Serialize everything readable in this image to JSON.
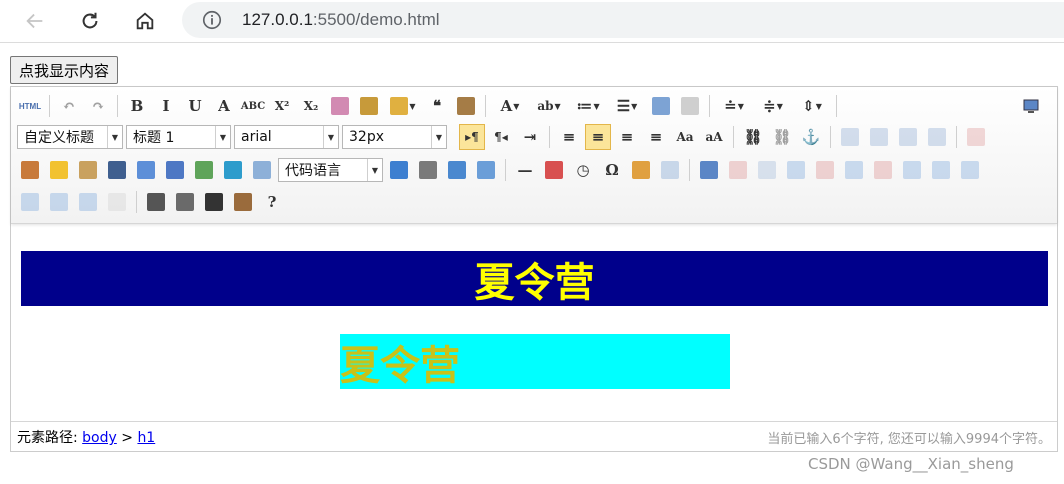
{
  "browser": {
    "url_host": "127.0.0.1",
    "url_rest": ":5500/demo.html"
  },
  "page": {
    "show_button": "点我显示内容"
  },
  "toolbar": {
    "row1": [
      {
        "name": "source-html-icon",
        "label": "HTML",
        "kind": "text"
      },
      {
        "sep": true
      },
      {
        "name": "undo-icon",
        "glyph": "↶",
        "disabled": true
      },
      {
        "name": "redo-icon",
        "glyph": "↷",
        "disabled": true
      },
      {
        "sep": true
      },
      {
        "name": "bold-icon",
        "glyph": "B"
      },
      {
        "name": "italic-icon",
        "glyph": "I"
      },
      {
        "name": "underline-icon",
        "glyph": "U"
      },
      {
        "name": "font-border-icon",
        "glyph": "A"
      },
      {
        "name": "strikethrough-icon",
        "glyph": "ABC"
      },
      {
        "name": "superscript-icon",
        "glyph": "X²"
      },
      {
        "name": "subscript-icon",
        "glyph": "X₂"
      },
      {
        "name": "eraser-icon",
        "color": "#d28ab2"
      },
      {
        "name": "format-brush-icon",
        "color": "#c79a3a"
      },
      {
        "name": "auto-format-icon",
        "color": "#e0b040",
        "caret": true
      },
      {
        "name": "blockquote-icon",
        "glyph": "❝"
      },
      {
        "name": "paste-plain-icon",
        "color": "#a57c46"
      },
      {
        "sep": true
      },
      {
        "name": "font-color-icon",
        "glyph": "A",
        "caret": true
      },
      {
        "name": "background-color-icon",
        "glyph": "ab",
        "caret": true
      },
      {
        "name": "ordered-list-icon",
        "glyph": "≔",
        "caret": true
      },
      {
        "name": "unordered-list-icon",
        "glyph": "☰",
        "caret": true
      },
      {
        "name": "select-all-icon",
        "color": "#7da3d4"
      },
      {
        "name": "clear-doc-icon",
        "color": "#cfcfcf"
      },
      {
        "sep": true
      },
      {
        "name": "row-spacing-top-icon",
        "glyph": "≐",
        "caret": true
      },
      {
        "name": "row-spacing-bottom-icon",
        "glyph": "≑",
        "caret": true
      },
      {
        "name": "line-height-icon",
        "glyph": "⇕",
        "caret": true
      },
      {
        "sep": true
      }
    ],
    "preview_icon": "preview-icon",
    "row2_combos": {
      "custom_style": "自定义标题",
      "paragraph": "标题 1",
      "font_family": "arial",
      "font_size": "32px"
    },
    "row2": [
      {
        "name": "direction-ltr-icon",
        "glyph": "▸¶",
        "active": true
      },
      {
        "name": "direction-rtl-icon",
        "glyph": "¶◂"
      },
      {
        "name": "indent-icon",
        "glyph": "⇥"
      },
      {
        "sep": true
      },
      {
        "name": "justify-left-icon",
        "glyph": "≡"
      },
      {
        "name": "justify-center-icon",
        "glyph": "≡",
        "active": true
      },
      {
        "name": "justify-right-icon",
        "glyph": "≡"
      },
      {
        "name": "justify-full-icon",
        "glyph": "≡"
      },
      {
        "name": "to-uppercase-icon",
        "glyph": "Aa"
      },
      {
        "name": "to-lowercase-icon",
        "glyph": "aA"
      },
      {
        "sep": true
      },
      {
        "name": "link-icon",
        "glyph": "⛓"
      },
      {
        "name": "unlink-icon",
        "glyph": "⛓",
        "disabled": true
      },
      {
        "name": "anchor-icon",
        "glyph": "⚓"
      },
      {
        "sep": true
      },
      {
        "name": "image-none-icon",
        "color": "#9fb8da",
        "disabled": true
      },
      {
        "name": "image-left-icon",
        "color": "#9fb8da",
        "disabled": true
      },
      {
        "name": "image-right-icon",
        "color": "#9fb8da",
        "disabled": true
      },
      {
        "name": "image-center-icon",
        "color": "#9fb8da",
        "disabled": true
      },
      {
        "sep": true
      },
      {
        "name": "simple-upload-icon",
        "color": "#e2a9a9",
        "disabled": true
      }
    ],
    "row3a": [
      {
        "name": "insert-image-icon",
        "color": "#c87a3b"
      },
      {
        "name": "emotion-icon",
        "color": "#f2c230"
      },
      {
        "name": "scrawl-icon",
        "color": "#c9a15f"
      },
      {
        "name": "insert-video-icon",
        "color": "#3f5f8f"
      },
      {
        "name": "music-icon",
        "color": "#5d8fd8"
      },
      {
        "name": "attachment-icon",
        "color": "#4e78c4"
      },
      {
        "name": "map-icon",
        "color": "#5fa45a"
      },
      {
        "name": "google-map-icon",
        "color": "#2d9ccc"
      },
      {
        "name": "insert-frame-icon",
        "color": "#8db0d8"
      }
    ],
    "code_language": "代码语言",
    "row3b": [
      {
        "name": "page-break-icon",
        "color": "#3d7fd0"
      },
      {
        "name": "page-break-marker-icon",
        "color": "#7a7a7a"
      },
      {
        "name": "template-icon",
        "color": "#4a88cf"
      },
      {
        "name": "background-icon",
        "color": "#6b9ed8"
      },
      {
        "sep": true
      },
      {
        "name": "horizontal-rule-icon",
        "glyph": "—"
      },
      {
        "name": "date-icon",
        "color": "#d85050"
      },
      {
        "name": "time-icon",
        "glyph": "◷"
      },
      {
        "name": "special-chars-icon",
        "glyph": "Ω"
      },
      {
        "name": "search-replace-icon",
        "color": "#e0a040"
      },
      {
        "name": "word-image-icon",
        "color": "#8db0d8",
        "disabled": true
      },
      {
        "sep": true
      },
      {
        "name": "insert-table-icon",
        "color": "#5b86c6"
      },
      {
        "name": "delete-table-icon",
        "color": "#e0a0a0",
        "disabled": true
      },
      {
        "name": "insert-paragraph-before-table-icon",
        "color": "#b0c4de",
        "disabled": true
      },
      {
        "name": "insert-row-icon",
        "color": "#8fb3e0",
        "disabled": true
      },
      {
        "name": "delete-row-icon",
        "color": "#e0a0a0",
        "disabled": true
      },
      {
        "name": "insert-col-icon",
        "color": "#8fb3e0",
        "disabled": true
      },
      {
        "name": "delete-col-icon",
        "color": "#e0a0a0",
        "disabled": true
      },
      {
        "name": "merge-cells-icon",
        "color": "#8fb3e0",
        "disabled": true
      },
      {
        "name": "merge-right-icon",
        "color": "#8fb3e0",
        "disabled": true
      },
      {
        "name": "merge-down-icon",
        "color": "#8fb3e0",
        "disabled": true
      }
    ],
    "row4": [
      {
        "name": "split-cells-icon",
        "color": "#8fb3e0",
        "disabled": true
      },
      {
        "name": "split-rows-icon",
        "color": "#8fb3e0",
        "disabled": true
      },
      {
        "name": "split-cols-icon",
        "color": "#8fb3e0",
        "disabled": true
      },
      {
        "name": "chart-icon",
        "color": "#d8d8d8",
        "disabled": true
      },
      {
        "sep": true
      },
      {
        "name": "print-icon",
        "color": "#555555"
      },
      {
        "name": "print-preview-icon",
        "color": "#6a6a6a"
      },
      {
        "name": "search-icon",
        "color": "#333333"
      },
      {
        "name": "drafts-icon",
        "color": "#9a6b3c"
      },
      {
        "name": "help-icon",
        "glyph": "?",
        "round": true
      }
    ]
  },
  "content": {
    "h1": "夏令营",
    "h2": "夏令营"
  },
  "status": {
    "path_label": "元素路径:",
    "path_body": "body",
    "path_sep": ">",
    "path_h1": "h1",
    "count": "当前已输入6个字符, 您还可以输入9994个字符。"
  },
  "watermark": "CSDN @Wang__Xian_sheng",
  "colors": {
    "banner_bg": "#00008b",
    "banner_text": "#ffff00",
    "box_bg": "#00ffff",
    "box_text": "#c9c218",
    "active_bg": "#fbe59a"
  }
}
